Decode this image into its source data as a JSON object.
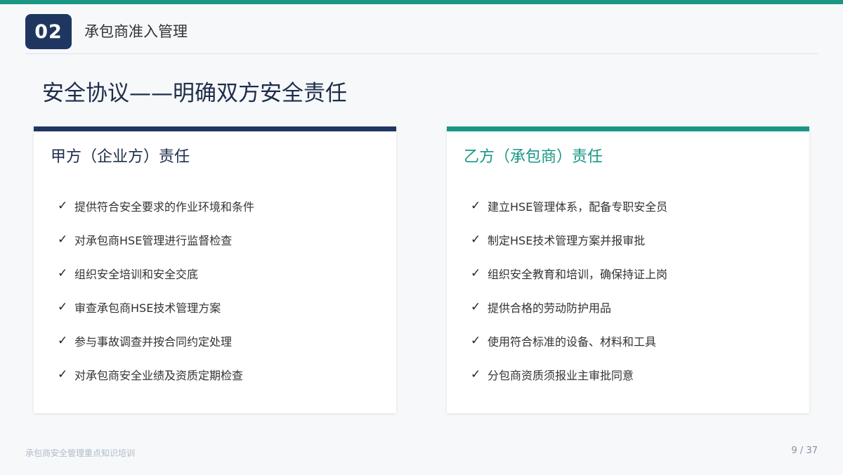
{
  "header": {
    "section_number": "02",
    "section_title": "承包商准入管理"
  },
  "page_title": "安全协议——明确双方安全责任",
  "left_card": {
    "title": "甲方（企业方）责任",
    "items": [
      "提供符合安全要求的作业环境和条件",
      "对承包商HSE管理进行监督检查",
      "组织安全培训和安全交底",
      "审查承包商HSE技术管理方案",
      "参与事故调查并按合同约定处理",
      "对承包商安全业绩及资质定期检查"
    ]
  },
  "right_card": {
    "title": "乙方（承包商）责任",
    "items": [
      "建立HSE管理体系，配备专职安全员",
      "制定HSE技术管理方案并报审批",
      "组织安全教育和培训，确保持证上岗",
      "提供合格的劳动防护用品",
      "使用符合标准的设备、材料和工具",
      "分包商资质须报业主审批同意"
    ]
  },
  "check_glyph": "✓",
  "footer": {
    "left": "承包商安全管理重点知识培训",
    "page": "9 / 37"
  },
  "colors": {
    "navy": "#1f3760",
    "teal": "#1a9784"
  }
}
